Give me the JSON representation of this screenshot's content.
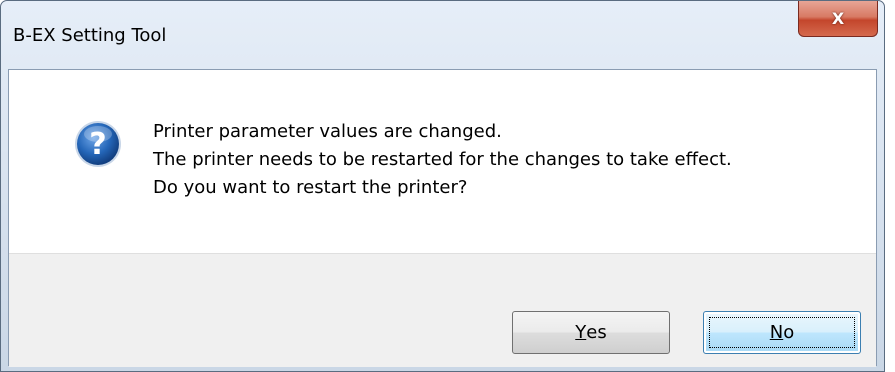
{
  "window": {
    "title": "B-EX Setting Tool",
    "close_glyph": "X"
  },
  "dialog": {
    "icon": "question-icon",
    "message_lines": [
      "Printer parameter values are changed.",
      "The printer needs to be restarted for the changes to take effect.",
      "Do you want to restart the printer?"
    ]
  },
  "buttons": {
    "yes": {
      "accel": "Y",
      "rest": "es"
    },
    "no": {
      "accel": "N",
      "rest": "o"
    },
    "default": "no"
  },
  "colors": {
    "question_icon_blue": "#1c5aa8",
    "close_button_red": "#c4462c",
    "default_button_border": "#3c7fb1"
  }
}
